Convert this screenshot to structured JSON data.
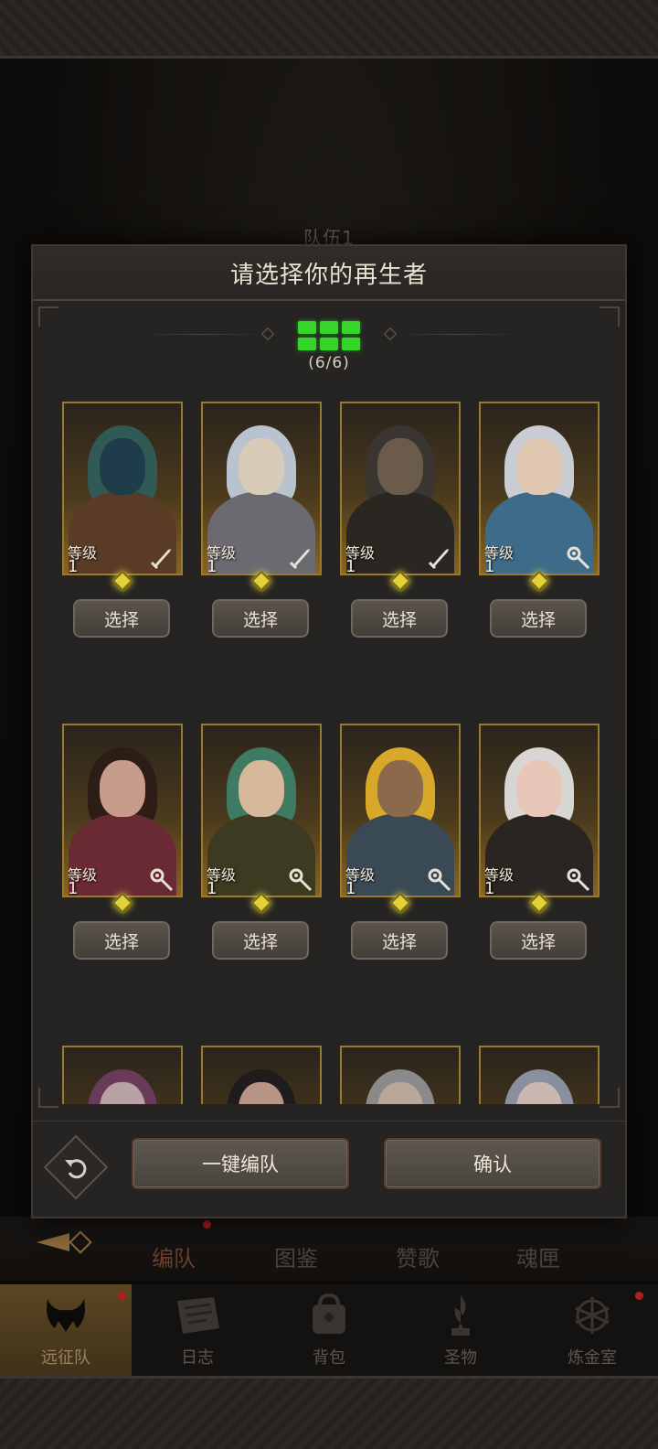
{
  "background": {
    "team_title": "队伍1"
  },
  "modal": {
    "title": "请选择你的再生者",
    "slot_count_text": "(6/6)",
    "slots_filled": 6,
    "slots_total": 6,
    "level_label": "等级",
    "select_label": "选择",
    "heroes": [
      {
        "level": "1",
        "class_icon": "sword-icon",
        "palette": [
          "#2f5a55",
          "#1f3c4a",
          "#5a3b25"
        ]
      },
      {
        "level": "1",
        "class_icon": "sword-icon",
        "palette": [
          "#b9c3cf",
          "#d8cbb8",
          "#6b6a70"
        ]
      },
      {
        "level": "1",
        "class_icon": "sword-icon",
        "palette": [
          "#3a3531",
          "#6b5b4a",
          "#2a2622"
        ]
      },
      {
        "level": "1",
        "class_icon": "staff-icon",
        "palette": [
          "#c9ccd3",
          "#e0c9b0",
          "#3f6b8a"
        ]
      },
      {
        "level": "1",
        "class_icon": "staff-icon",
        "palette": [
          "#2d1d16",
          "#c89c8a",
          "#6a2a33"
        ]
      },
      {
        "level": "1",
        "class_icon": "staff-icon",
        "palette": [
          "#3f7a62",
          "#d8b89a",
          "#3d3a22"
        ]
      },
      {
        "level": "1",
        "class_icon": "staff-icon",
        "palette": [
          "#d8a82a",
          "#8a6a4a",
          "#3a4a55"
        ]
      },
      {
        "level": "1",
        "class_icon": "staff-icon",
        "palette": [
          "#d8d6d2",
          "#e8c6b8",
          "#2a2522"
        ]
      },
      {
        "level": "",
        "class_icon": "",
        "palette": [
          "#6a3a5a",
          "#b8a2a6",
          "#3a2a35"
        ]
      },
      {
        "level": "",
        "class_icon": "",
        "palette": [
          "#1f1c1e",
          "#b89484",
          "#2a2630"
        ]
      },
      {
        "level": "",
        "class_icon": "",
        "palette": [
          "#8a8a8a",
          "#b9a79a",
          "#4a4a55"
        ]
      },
      {
        "level": "",
        "class_icon": "",
        "palette": [
          "#8a8fa0",
          "#c9b7b0",
          "#3f4660"
        ]
      }
    ],
    "auto_team_label": "一键编队",
    "confirm_label": "确认"
  },
  "sub_tabs": [
    {
      "label": "编队",
      "active": true
    },
    {
      "label": "图鉴",
      "active": false
    },
    {
      "label": "赞歌",
      "active": false
    },
    {
      "label": "魂匣",
      "active": false
    }
  ],
  "nav": [
    {
      "label": "远征队",
      "icon": "helmet-icon",
      "active": true
    },
    {
      "label": "日志",
      "icon": "scroll-icon",
      "active": false
    },
    {
      "label": "背包",
      "icon": "bag-icon",
      "active": false
    },
    {
      "label": "圣物",
      "icon": "relic-icon",
      "active": false
    },
    {
      "label": "炼金室",
      "icon": "alchemy-icon",
      "active": false
    }
  ],
  "colors": {
    "accent_gold": "#9a7a30",
    "slot_green": "#35d62a",
    "notify_red": "#b01f1f"
  }
}
